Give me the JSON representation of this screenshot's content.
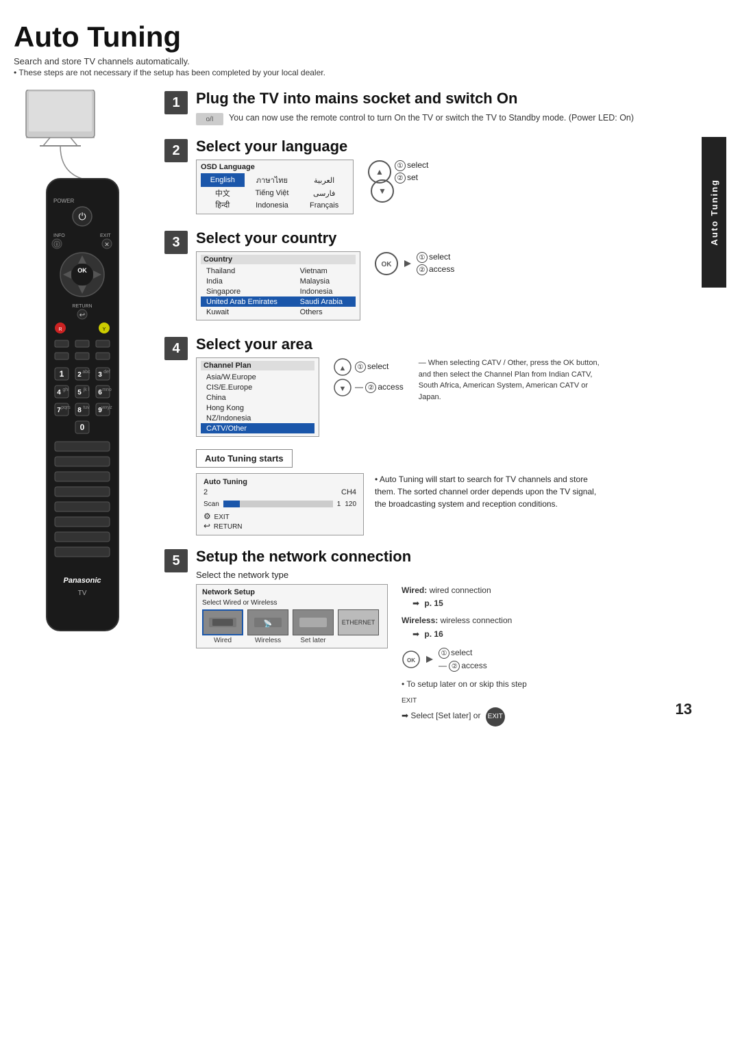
{
  "page": {
    "title": "Auto Tuning",
    "subtitle1": "Search and store TV channels automatically.",
    "subtitle2": "These steps are not necessary if the setup has been completed by your local dealer.",
    "page_number": "13",
    "side_tab": "Auto Tuning"
  },
  "steps": [
    {
      "number": "1",
      "heading": "Plug the TV into mains socket and switch On",
      "power_label": "o/I",
      "body": "You can now use the remote control to turn On the TV or switch the TV to Standby mode. (Power LED: On)"
    },
    {
      "number": "2",
      "heading": "Select your language",
      "table_header": "OSD Language",
      "instructions": [
        "① select",
        "② set"
      ],
      "languages": [
        [
          "English",
          "ภาษาไทย",
          "العربية"
        ],
        [
          "中文",
          "Tiếng Việt",
          "فارسی"
        ],
        [
          "हिन्दी",
          "Indonesia",
          "Français"
        ]
      ],
      "selected": "English"
    },
    {
      "number": "3",
      "heading": "Select your country",
      "table_header": "Country",
      "instructions": [
        "① select",
        "② access"
      ],
      "countries": [
        [
          "Thailand",
          "Vietnam"
        ],
        [
          "India",
          "Malaysia"
        ],
        [
          "Singapore",
          "Indonesia"
        ],
        [
          "United Arab Emirates",
          "Saudi Arabia"
        ],
        [
          "Kuwait",
          "Others"
        ]
      ],
      "highlighted_row": 3
    },
    {
      "number": "4",
      "heading": "Select your area",
      "table_header": "Channel Plan",
      "instructions": [
        "① select",
        "② access"
      ],
      "areas": [
        "Asia/W.Europe",
        "CIS/E.Europe",
        "China",
        "Hong Kong",
        "NZ/Indonesia",
        "CATV/Other"
      ],
      "highlighted_row": 5,
      "catv_note": "When selecting CATV / Other, press the OK button, and then select the Channel Plan from Indian CATV, South Africa, American System, American CATV or Japan.",
      "auto_tuning_starts_label": "Auto Tuning starts",
      "auto_tuning_screen": {
        "header": "Auto Tuning",
        "row1_label": "2",
        "row1_ch": "CH4",
        "scan_label": "Scan",
        "scan_val": "1",
        "scan_end": "120",
        "exit_label": "EXIT",
        "return_label": "RETURN"
      },
      "auto_tuning_note": "Auto Tuning will start to search for TV channels and store them. The sorted channel order depends upon the TV signal, the broadcasting system and reception conditions."
    },
    {
      "number": "5",
      "heading": "Setup the network connection",
      "sub_label": "Select the network type",
      "network_header": "Network Setup",
      "network_select_label": "Select Wired or Wireless",
      "network_options": [
        "Wired",
        "Wireless",
        "Set later"
      ],
      "ethernet_label": "ETHERNET",
      "wired_label": "Wired:",
      "wired_desc": "wired connection",
      "wired_page": "p. 15",
      "wireless_label": "Wireless:",
      "wireless_desc": "wireless connection",
      "wireless_page": "p. 16",
      "instructions": [
        "① select",
        "② access"
      ],
      "note1": "To setup later on or skip this step",
      "exit_label": "EXIT",
      "note2": "➡ Select [Set later] or"
    }
  ]
}
